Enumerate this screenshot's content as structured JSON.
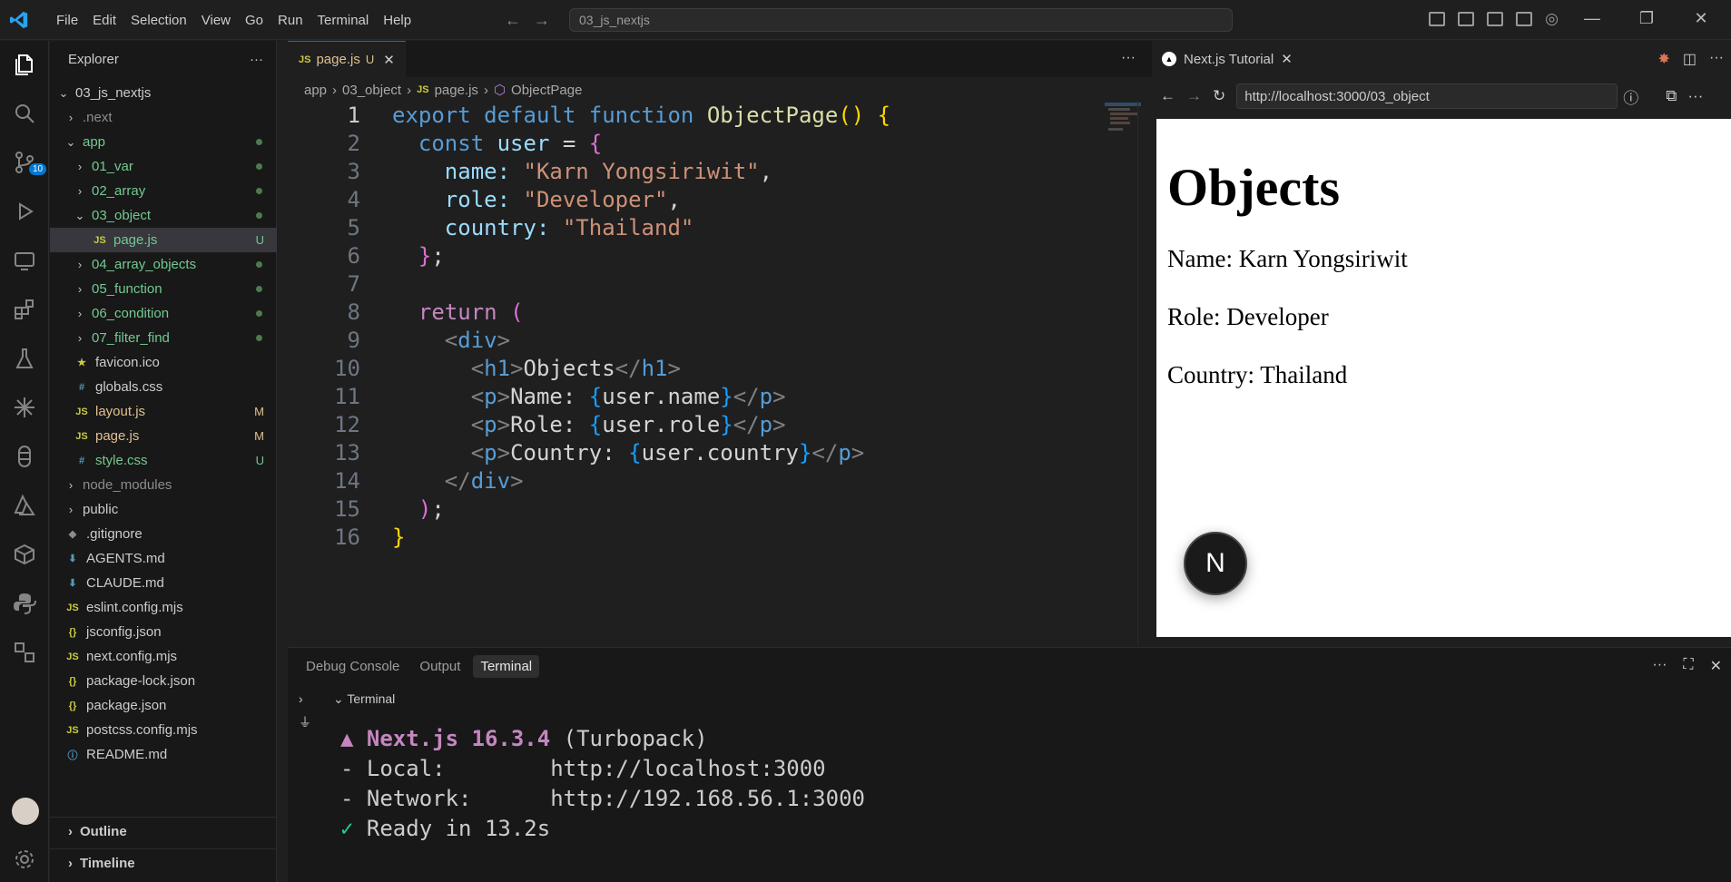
{
  "titlebar": {
    "menu": [
      "File",
      "Edit",
      "Selection",
      "View",
      "Go",
      "Run",
      "Terminal",
      "Help"
    ],
    "search": "03_js_nextjs"
  },
  "activity": {
    "scm_badge": "10"
  },
  "explorer": {
    "title": "Explorer",
    "root": "03_js_nextjs",
    "items": [
      {
        "label": ".next",
        "color": "grey"
      },
      {
        "label": "app",
        "color": "green"
      },
      {
        "label": "01_var",
        "color": "green"
      },
      {
        "label": "02_array",
        "color": "green"
      },
      {
        "label": "03_object",
        "color": "green"
      },
      {
        "label": "page.js",
        "status": "U"
      },
      {
        "label": "04_array_objects",
        "color": "green"
      },
      {
        "label": "05_function",
        "color": "green"
      },
      {
        "label": "06_condition",
        "color": "green"
      },
      {
        "label": "07_filter_find",
        "color": "green"
      },
      {
        "label": "favicon.ico"
      },
      {
        "label": "globals.css"
      },
      {
        "label": "layout.js",
        "status": "M"
      },
      {
        "label": "page.js",
        "status": "M"
      },
      {
        "label": "style.css",
        "status": "U"
      },
      {
        "label": "node_modules"
      },
      {
        "label": "public"
      },
      {
        "label": ".gitignore"
      },
      {
        "label": "AGENTS.md"
      },
      {
        "label": "CLAUDE.md"
      },
      {
        "label": "eslint.config.mjs"
      },
      {
        "label": "jsconfig.json"
      },
      {
        "label": "next.config.mjs"
      },
      {
        "label": "package-lock.json"
      },
      {
        "label": "package.json"
      },
      {
        "label": "postcss.config.mjs"
      },
      {
        "label": "README.md"
      }
    ],
    "outline": "Outline",
    "timeline": "Timeline"
  },
  "editor": {
    "tab_label": "page.js",
    "tab_status": "U",
    "breadcrumb": [
      "app",
      "03_object",
      "page.js",
      "ObjectPage"
    ],
    "line_numbers": [
      "1",
      "2",
      "3",
      "4",
      "5",
      "6",
      "7",
      "8",
      "9",
      "10",
      "11",
      "12",
      "13",
      "14",
      "15",
      "16"
    ],
    "lines": {
      "l1": [
        "export",
        "default",
        "function",
        "ObjectPage",
        "()",
        "{"
      ],
      "l2": [
        "const",
        "user",
        "=",
        "{"
      ],
      "l3": [
        "name:",
        "\"Karn Yongsiriwit\"",
        ","
      ],
      "l4": [
        "role:",
        "\"Developer\"",
        ","
      ],
      "l5": [
        "country:",
        "\"Thailand\""
      ],
      "l6": [
        "}",
        ";"
      ],
      "l8": [
        "return",
        "("
      ],
      "l9": [
        "<",
        "div",
        ">"
      ],
      "l10": [
        "<",
        "h1",
        ">",
        "Objects",
        "</",
        "h1",
        ">"
      ],
      "l11": [
        "<",
        "p",
        ">",
        "Name: ",
        "{",
        "user.name",
        "}",
        "</",
        "p",
        ">"
      ],
      "l12": [
        "<",
        "p",
        ">",
        "Role: ",
        "{",
        "user.role",
        "}",
        "</",
        "p",
        ">"
      ],
      "l13": [
        "<",
        "p",
        ">",
        "Country: ",
        "{",
        "user.country",
        "}",
        "</",
        "p",
        ">"
      ],
      "l14": [
        "</",
        "div",
        ">"
      ],
      "l15": [
        ")",
        ";"
      ],
      "l16": [
        "}"
      ]
    }
  },
  "browser": {
    "tab_title": "Next.js Tutorial",
    "url": "http://localhost:3000/03_object",
    "page": {
      "heading": "Objects",
      "name": "Name: Karn Yongsiriwit",
      "role": "Role: Developer",
      "country": "Country: Thailand"
    },
    "fab": "N"
  },
  "panel": {
    "tabs": [
      "Debug Console",
      "Output",
      "Terminal"
    ],
    "active_tab": "Terminal",
    "terminal_title": "Terminal",
    "terminal": {
      "l1_prefix": "▲ Next.js 16.3.4",
      "l1_rest": " (Turbopack)",
      "l2": "- Local:        http://localhost:3000",
      "l3": "- Network:      http://192.168.56.1:3000",
      "l4_check": "✓",
      "l4_rest": " Ready in 13.2s"
    }
  }
}
